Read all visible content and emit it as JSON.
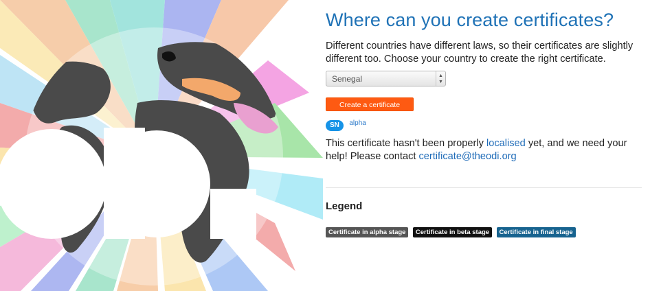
{
  "page": {
    "title": "Where can you create certificates?",
    "intro": "Different countries have different laws, so their certificates are slightly different too. Choose your country to create the right certificate."
  },
  "country_select": {
    "value": "Senegal"
  },
  "create_button": {
    "label": "Create a certificate"
  },
  "country_badge": {
    "code": "SN",
    "stage": "alpha"
  },
  "notice": {
    "text_before": "This certificate hasn't been properly ",
    "link_localised": "localised",
    "text_middle": " yet, and we need your help! Please contact ",
    "link_email": "certificate@theodi.org"
  },
  "legend": {
    "title": "Legend",
    "items": [
      {
        "label": "Certificate in alpha stage",
        "color": "#555555"
      },
      {
        "label": "Certificate in beta stage",
        "color": "#111111"
      },
      {
        "label": "Certificate in final stage",
        "color": "#17638f"
      }
    ]
  },
  "colors": {
    "title_blue": "#1f72b6",
    "button_orange": "#fe5a12",
    "badge_blue": "#1693e7",
    "link_blue": "#1e6bb8",
    "land_gray": "#4a4a4a",
    "highlight_country": "#2f8fdc",
    "europe_highlight": "#f3a86b"
  }
}
